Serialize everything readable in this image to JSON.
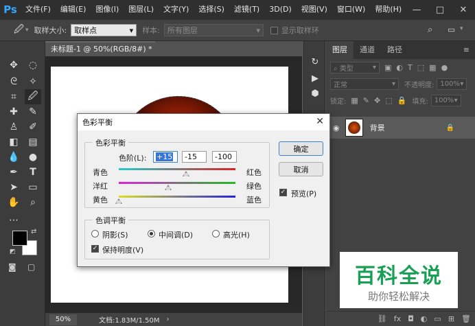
{
  "app": {
    "logo": "Ps",
    "menu": [
      "文件(F)",
      "编辑(E)",
      "图像(I)",
      "图层(L)",
      "文字(Y)",
      "选择(S)",
      "滤镜(T)",
      "3D(D)",
      "视图(V)",
      "窗口(W)",
      "帮助(H)"
    ],
    "window_controls": [
      "—",
      "□",
      "✕"
    ]
  },
  "options": {
    "sample_size_label": "取样大小:",
    "sample_size_value": "取样点",
    "sample_label": "样本:",
    "sample_value": "所有图层",
    "show_ring_label": "显示取样环"
  },
  "document": {
    "tab_title": "未标题-1 @ 50%(RGB/8#) *",
    "zoom": "50%",
    "doc_size": "文档:1.83M/1.50M"
  },
  "layers": {
    "tabs": [
      "图层",
      "通道",
      "路径"
    ],
    "filter_label": "类型",
    "blend_mode": "正常",
    "opacity_label": "不透明度:",
    "opacity_value": "100%",
    "lock_label": "锁定:",
    "fill_label": "填充:",
    "fill_value": "100%",
    "layer_name": "背景"
  },
  "dialog": {
    "title": "色彩平衡",
    "color_balance_group": "色彩平衡",
    "levels_label": "色阶(L):",
    "levels": [
      "+15",
      "-15",
      "-100"
    ],
    "sliders": [
      {
        "left": "青色",
        "right": "红色",
        "value": 15,
        "from": "#22cccc",
        "to": "#dd2222"
      },
      {
        "left": "洋红",
        "right": "绿色",
        "value": -15,
        "from": "#dd22dd",
        "to": "#22bb22"
      },
      {
        "left": "黄色",
        "right": "蓝色",
        "value": -100,
        "from": "#dddd22",
        "to": "#2222dd"
      }
    ],
    "tone_group": "色调平衡",
    "shadows": "阴影(S)",
    "midtones": "中间调(D)",
    "highlights": "高光(H)",
    "selected_tone": "midtones",
    "preserve_luminosity": "保持明度(V)",
    "ok": "确定",
    "cancel": "取消",
    "preview": "预览(P)"
  },
  "watermark": {
    "title": "百科全说",
    "subtitle": "助你轻松解决"
  }
}
